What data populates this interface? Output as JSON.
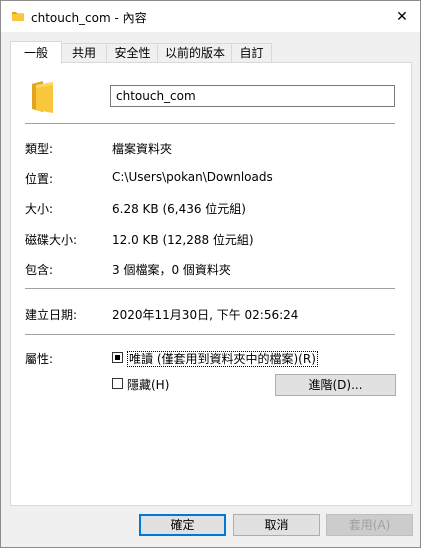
{
  "window": {
    "title": "chtouch_com - 內容",
    "close_glyph": "✕"
  },
  "tabs": [
    {
      "label": "一般",
      "active": true
    },
    {
      "label": "共用",
      "active": false
    },
    {
      "label": "安全性",
      "active": false
    },
    {
      "label": "以前的版本",
      "active": false
    },
    {
      "label": "自訂",
      "active": false
    }
  ],
  "general": {
    "folder_name": "chtouch_com",
    "rows": [
      {
        "label": "類型:",
        "value": "檔案資料夾"
      },
      {
        "label": "位置:",
        "value": "C:\\Users\\pokan\\Downloads"
      },
      {
        "label": "大小:",
        "value": "6.28 KB (6,436 位元組)"
      },
      {
        "label": "磁碟大小:",
        "value": "12.0 KB (12,288 位元組)"
      },
      {
        "label": "包含:",
        "value": "3 個檔案，0 個資料夾"
      }
    ],
    "created": {
      "label": "建立日期:",
      "value": "2020年11月30日, 下午 02:56:24"
    },
    "attributes": {
      "label": "屬性:",
      "readonly_label": "唯讀 (僅套用到資料夾中的檔案)(R)",
      "hidden_label": "隱藏(H)",
      "advanced_label": "進階(D)..."
    }
  },
  "buttons": {
    "ok": "確定",
    "cancel": "取消",
    "apply": "套用(A)"
  },
  "colors": {
    "folder_yellow": "#f8c73c",
    "folder_shade": "#e0a622",
    "focus_blue": "#0078d7"
  }
}
